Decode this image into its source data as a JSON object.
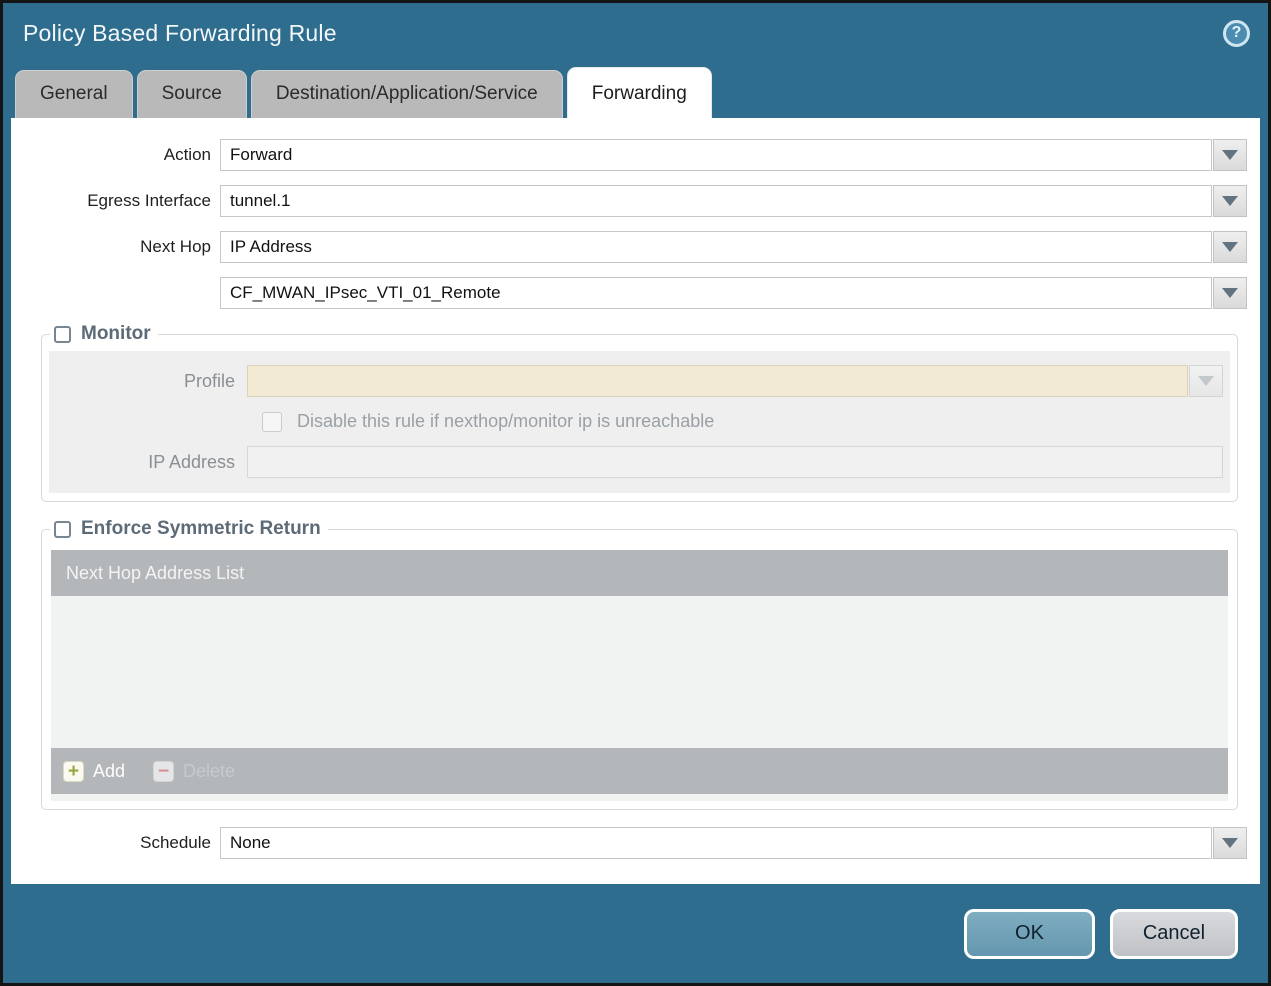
{
  "window": {
    "title": "Policy Based Forwarding Rule",
    "help_glyph": "?"
  },
  "tabs": [
    {
      "label": "General",
      "active": false
    },
    {
      "label": "Source",
      "active": false
    },
    {
      "label": "Destination/Application/Service",
      "active": false
    },
    {
      "label": "Forwarding",
      "active": true
    }
  ],
  "form": {
    "action": {
      "label": "Action",
      "value": "Forward"
    },
    "egress_interface": {
      "label": "Egress Interface",
      "value": "tunnel.1"
    },
    "next_hop": {
      "label": "Next Hop",
      "value": "IP Address"
    },
    "next_hop_address": {
      "label": "",
      "value": "CF_MWAN_IPsec_VTI_01_Remote"
    },
    "schedule": {
      "label": "Schedule",
      "value": "None"
    }
  },
  "monitor": {
    "label": "Monitor",
    "checked": false,
    "profile": {
      "label": "Profile",
      "value": ""
    },
    "disable_rule": {
      "label": "Disable this rule if nexthop/monitor ip is unreachable",
      "checked": false
    },
    "ip_address": {
      "label": "IP Address",
      "value": ""
    }
  },
  "enforce_symmetric_return": {
    "label": "Enforce Symmetric Return",
    "checked": false,
    "table": {
      "header": "Next Hop Address List",
      "rows": []
    },
    "add_label": "Add",
    "delete_label": "Delete"
  },
  "footer": {
    "ok_label": "OK",
    "cancel_label": "Cancel"
  },
  "colors": {
    "titlebar": "#2f6d8e",
    "tab_inactive": "#b9b9b9",
    "tab_active": "#ffffff",
    "profile_disabled_bg": "#f3ead3",
    "table_header": "#b3b7ba",
    "table_body": "#f1f2f2",
    "ok_button": "#72a3b9",
    "cancel_button": "#caccd0",
    "add_plus": "#99a53f",
    "delete_minus": "#d98f93",
    "legend_text": "#5d6b78"
  }
}
